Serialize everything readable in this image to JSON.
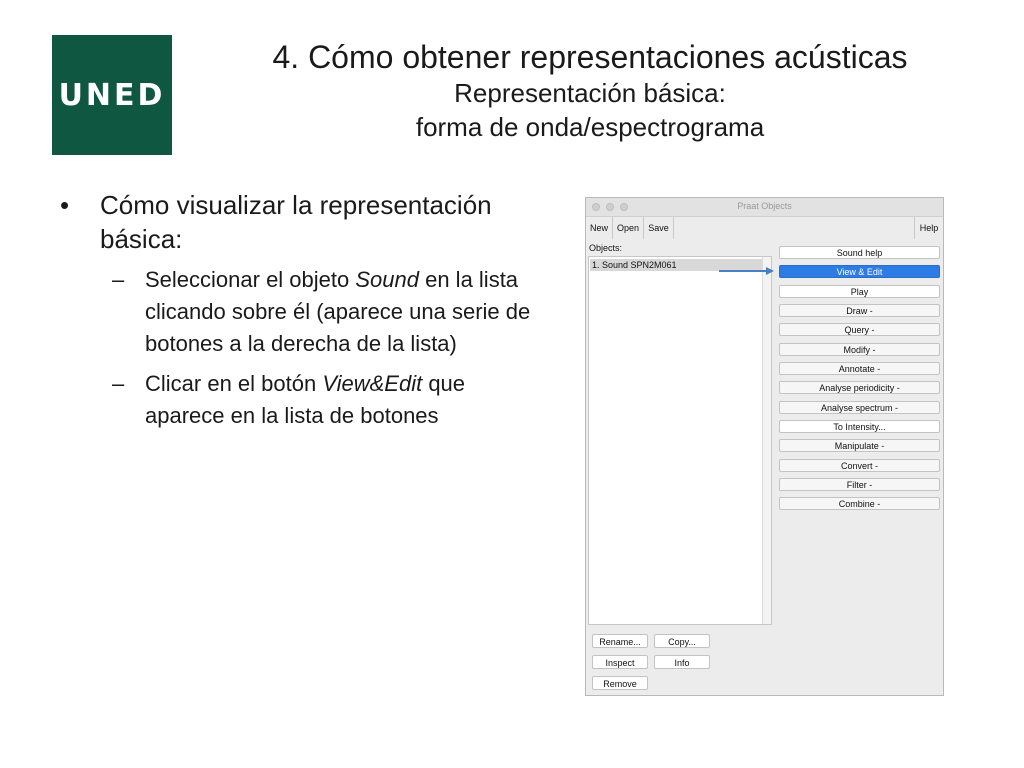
{
  "logo": {
    "text": "UNED",
    "color": "#0f5740"
  },
  "title": {
    "main": "4. Cómo obtener representaciones acústicas",
    "sub1": "Representación básica:",
    "sub2": "forma de onda/espectrograma"
  },
  "content": {
    "bullet_marker": "•",
    "bullet": "Cómo visualizar la representación básica:",
    "dash": "–",
    "item1": {
      "pre": "Seleccionar el objeto ",
      "em": "Sound",
      "post": " en la lista clicando sobre él (aparece una serie de botones a la derecha de la lista)"
    },
    "item2": {
      "pre": "Clicar en el botón ",
      "em": "View&Edit",
      "post": " que aparece en la lista de botones"
    }
  },
  "praat": {
    "window_title": "Praat Objects",
    "menu": {
      "new": "New",
      "open": "Open",
      "save": "Save",
      "help": "Help"
    },
    "objects_label": "Objects:",
    "objects": [
      "1. Sound SPN2M061"
    ],
    "actions": [
      "Sound help",
      "View & Edit",
      "Play",
      "Draw -",
      "Query -",
      "Modify -",
      "Annotate -",
      "Analyse periodicity -",
      "Analyse spectrum -",
      "To Intensity...",
      "Manipulate -",
      "Convert -",
      "Filter -",
      "Combine -"
    ],
    "bottom": {
      "rename": "Rename...",
      "copy": "Copy...",
      "inspect": "Inspect",
      "info": "Info",
      "remove": "Remove"
    },
    "selected_color": "#2d7be5",
    "arrow_color": "#4a7fc1"
  }
}
